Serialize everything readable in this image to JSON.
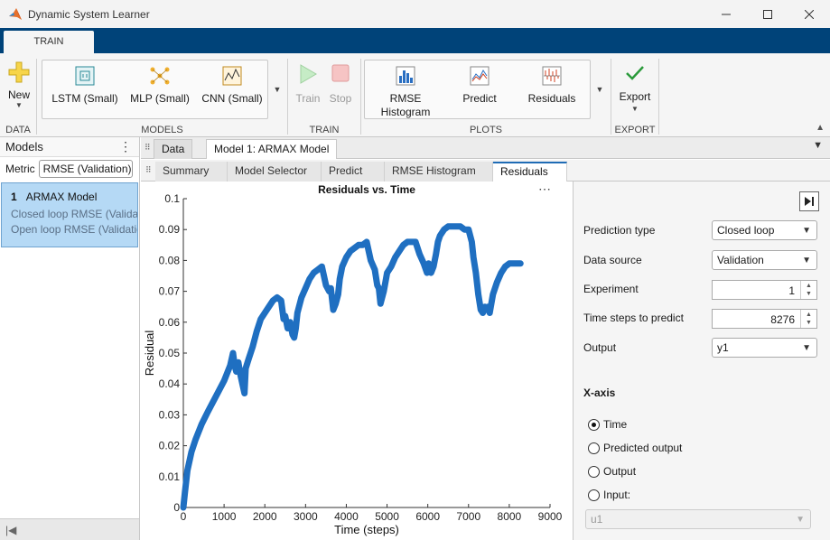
{
  "window": {
    "title": "Dynamic System Learner"
  },
  "tabs": {
    "train": "TRAIN"
  },
  "toolstrip": {
    "data": {
      "label": "DATA",
      "new": "New"
    },
    "models": {
      "label": "MODELS",
      "items": [
        "LSTM (Small)",
        "MLP (Small)",
        "CNN (Small)"
      ]
    },
    "train": {
      "label": "TRAIN",
      "train_btn": "Train",
      "stop_btn": "Stop"
    },
    "plots": {
      "label": "PLOTS",
      "rmse_l1": "RMSE",
      "rmse_l2": "Histogram",
      "predict": "Predict",
      "residuals": "Residuals"
    },
    "export": {
      "label": "EXPORT",
      "export_btn": "Export"
    }
  },
  "left_panel": {
    "title": "Models",
    "metric_label": "Metric",
    "metric_value": "RMSE (Validation)",
    "model": {
      "index": "1",
      "name": "ARMAX Model",
      "closed": "Closed loop RMSE (Validation)",
      "open": "Open loop RMSE (Validation)"
    }
  },
  "doc_tabs": [
    "Data",
    "Model 1: ARMAX Model"
  ],
  "sub_tabs": [
    "Summary",
    "Model Selector",
    "Predict",
    "RMSE Histogram",
    "Residuals"
  ],
  "settings": {
    "prediction_type_label": "Prediction type",
    "prediction_type": "Closed loop",
    "data_source_label": "Data source",
    "data_source": "Validation",
    "experiment_label": "Experiment",
    "experiment": "1",
    "time_steps_label": "Time steps to predict",
    "time_steps": "8276",
    "output_label": "Output",
    "output": "y1",
    "xaxis_heading": "X-axis",
    "xaxis_options": [
      "Time",
      "Predicted output",
      "Output",
      "Input:"
    ],
    "xaxis_selected": "Time",
    "input_value": "u1"
  },
  "chart_data": {
    "type": "line",
    "title": "Residuals vs. Time",
    "xlabel": "Time (steps)",
    "ylabel": "Residual",
    "xlim": [
      0,
      9000
    ],
    "ylim": [
      0,
      0.1
    ],
    "xticks": [
      "0",
      "1000",
      "2000",
      "3000",
      "4000",
      "5000",
      "6000",
      "7000",
      "8000",
      "9000"
    ],
    "yticks": [
      "0",
      "0.01",
      "0.02",
      "0.03",
      "0.04",
      "0.05",
      "0.06",
      "0.07",
      "0.08",
      "0.09",
      "0.1"
    ],
    "color": "#1f6fc1",
    "series": [
      {
        "x": [
          0,
          40,
          100,
          200,
          300,
          450,
          600,
          800,
          1000,
          1150,
          1220,
          1260,
          1300,
          1350,
          1400,
          1450,
          1500,
          1530,
          1600,
          1700,
          1800,
          1900,
          2000,
          2100,
          2200,
          2300,
          2400,
          2460,
          2500,
          2560,
          2620,
          2680,
          2720,
          2760,
          2800,
          2900,
          3000,
          3100,
          3200,
          3300,
          3400,
          3500,
          3580,
          3620,
          3680,
          3740,
          3800,
          3840,
          3900,
          4000,
          4100,
          4200,
          4300,
          4400,
          4500,
          4600,
          4700,
          4760,
          4800,
          4840,
          4880,
          4920,
          4960,
          5000,
          5100,
          5200,
          5300,
          5400,
          5500,
          5600,
          5700,
          5800,
          5900,
          5980,
          6020,
          6080,
          6140,
          6200,
          6250,
          6300,
          6400,
          6500,
          6600,
          6700,
          6800,
          6900,
          7000,
          7080,
          7120,
          7180,
          7240,
          7300,
          7350,
          7400,
          7440,
          7480,
          7520,
          7560,
          7600,
          7700,
          7800,
          7900,
          8000,
          8100,
          8200,
          8276
        ],
        "y": [
          0.0,
          0.005,
          0.012,
          0.018,
          0.022,
          0.027,
          0.031,
          0.036,
          0.041,
          0.046,
          0.05,
          0.046,
          0.044,
          0.047,
          0.043,
          0.04,
          0.037,
          0.045,
          0.048,
          0.052,
          0.057,
          0.061,
          0.063,
          0.065,
          0.067,
          0.068,
          0.067,
          0.061,
          0.062,
          0.058,
          0.06,
          0.056,
          0.055,
          0.058,
          0.063,
          0.068,
          0.071,
          0.074,
          0.076,
          0.077,
          0.078,
          0.072,
          0.07,
          0.071,
          0.064,
          0.066,
          0.069,
          0.074,
          0.078,
          0.081,
          0.083,
          0.084,
          0.085,
          0.085,
          0.086,
          0.08,
          0.077,
          0.072,
          0.071,
          0.066,
          0.068,
          0.07,
          0.073,
          0.076,
          0.078,
          0.081,
          0.083,
          0.085,
          0.086,
          0.086,
          0.086,
          0.082,
          0.079,
          0.076,
          0.079,
          0.076,
          0.078,
          0.082,
          0.086,
          0.088,
          0.09,
          0.091,
          0.091,
          0.091,
          0.091,
          0.09,
          0.09,
          0.086,
          0.081,
          0.076,
          0.069,
          0.064,
          0.063,
          0.065,
          0.064,
          0.065,
          0.063,
          0.066,
          0.069,
          0.073,
          0.076,
          0.078,
          0.079,
          0.079,
          0.079,
          0.079
        ]
      }
    ]
  }
}
